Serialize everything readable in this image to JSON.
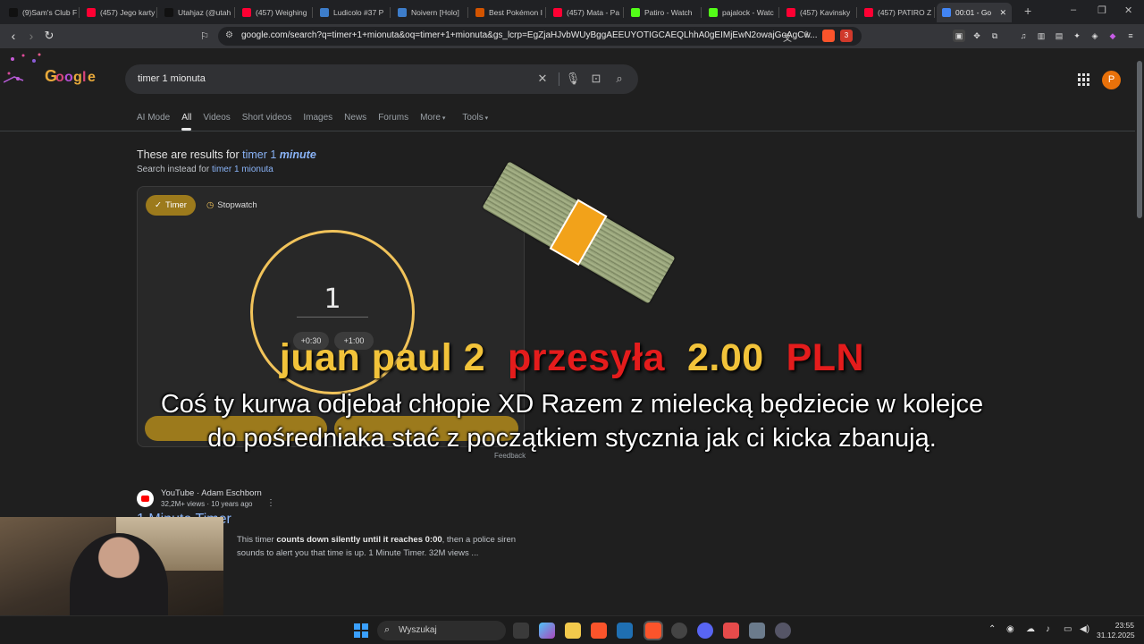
{
  "browser": {
    "tabs": [
      {
        "label": "(9)Sam's Club F",
        "icon": "tiktok-icon",
        "color": "#111111"
      },
      {
        "label": "(457) Jego karty",
        "icon": "youtube-icon",
        "color": "#ff0033"
      },
      {
        "label": "Utahjaz (@utah",
        "icon": "tiktok-icon",
        "color": "#111111"
      },
      {
        "label": "(457) Weighing",
        "icon": "youtube-icon",
        "color": "#ff0033"
      },
      {
        "label": "Ludicolo #37 P",
        "icon": "pokemon-icon",
        "color": "#3d7dca"
      },
      {
        "label": "Noivern [Holo]",
        "icon": "pokemon-icon",
        "color": "#3d7dca"
      },
      {
        "label": "Best Pokémon I",
        "icon": "site-icon",
        "color": "#d35400"
      },
      {
        "label": "(457) Mata - Pa",
        "icon": "youtube-icon",
        "color": "#ff0033"
      },
      {
        "label": "Patiro - Watch",
        "icon": "kick-icon",
        "color": "#53fc18"
      },
      {
        "label": "pajalock - Watc",
        "icon": "kick-icon",
        "color": "#53fc18"
      },
      {
        "label": "(457) Kavinsky",
        "icon": "youtube-icon",
        "color": "#ff0033"
      },
      {
        "label": "(457) PATIRO Z",
        "icon": "youtube-icon",
        "color": "#ff0033"
      },
      {
        "label": "00:01 - Go",
        "icon": "google-icon",
        "color": "#4285f4",
        "active": true
      }
    ],
    "new_tab": "+",
    "url": "google.com/search?q=timer+1+mionuta&oq=timer+1+mionuta&gs_lcrp=EgZjaHJvbWUyBggAEEUYOTIGCAEQLhhA0gEIMjEwN2owajGoAgCw...",
    "brave_badge": "3"
  },
  "search": {
    "query": "timer 1 mionuta",
    "tabs": [
      "AI Mode",
      "All",
      "Videos",
      "Short videos",
      "Images",
      "News",
      "Forums",
      "More",
      "Tools"
    ],
    "active_tab": "All",
    "correction_prefix": "These are results for ",
    "correction_link": "timer 1 ",
    "correction_em": "minute",
    "instead_prefix": "Search instead for ",
    "instead_link": "timer 1 mionuta"
  },
  "timer": {
    "timer_chip": "Timer",
    "stopwatch_chip": "Stopwatch",
    "value": "1",
    "add30": "+0:30",
    "add60": "+1:00",
    "feedback": "Feedback",
    "accent_color": "#f1c35a"
  },
  "result": {
    "source": "YouTube · Adam Eschborn",
    "meta": "32,2M+ views · 10 years ago",
    "title": "1 Minute Timer",
    "snippet_pre": "This timer ",
    "snippet_bold": "counts down silently until it reaches 0:00",
    "snippet_post": ", then a police siren sounds to alert you that time is up. 1 Minute Timer. 32M views ..."
  },
  "overlay": {
    "donor": "juan paul 2",
    "action": "przesyła",
    "amount": "2.00",
    "currency": "PLN",
    "message": "Coś ty kurwa odjebał chłopie XD Razem z mielecką będziecie w kolejce do pośredniaka stać z początkiem stycznia jak ci kicka zbanują."
  },
  "taskbar": {
    "search_placeholder": "Wyszukaj",
    "time": "23:55",
    "date": "31.12.2025"
  }
}
